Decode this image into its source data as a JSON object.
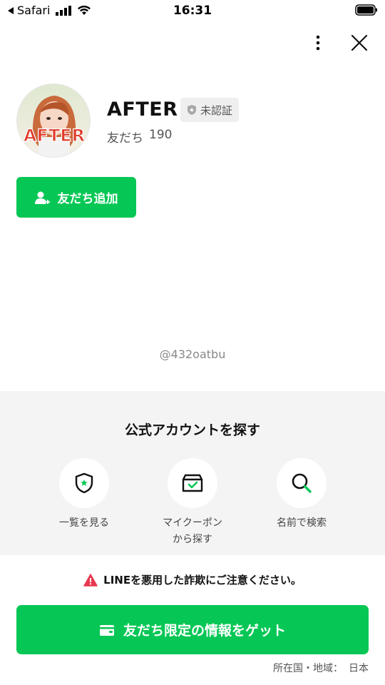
{
  "status_bar": {
    "back_app": "Safari",
    "time": "16:31"
  },
  "profile": {
    "name": "AFTER",
    "badge_label": "未認証",
    "friends_label": "友だち",
    "friends_count": "190",
    "avatar_text": "AFTER",
    "add_friend_label": "友だち追加"
  },
  "account_id": "@432oatbu",
  "explore": {
    "title": "公式アカウントを探す",
    "items": [
      {
        "label": "一覧を見る",
        "icon": "shield-star-icon"
      },
      {
        "label": "マイクーポン\nから探す",
        "icon": "coupon-box-icon"
      },
      {
        "label": "名前で検索",
        "icon": "search-icon"
      }
    ]
  },
  "warning_text": "LINEを悪用した詐欺にご注意ください。",
  "cta_label": "友だち限定の情報をゲット",
  "footer": {
    "region_label": "所在国・地域：",
    "region_value": "日本"
  },
  "colors": {
    "brand_green": "#06c755",
    "warning_red": "#e8384f",
    "explore_bg": "#f4f4f4"
  }
}
